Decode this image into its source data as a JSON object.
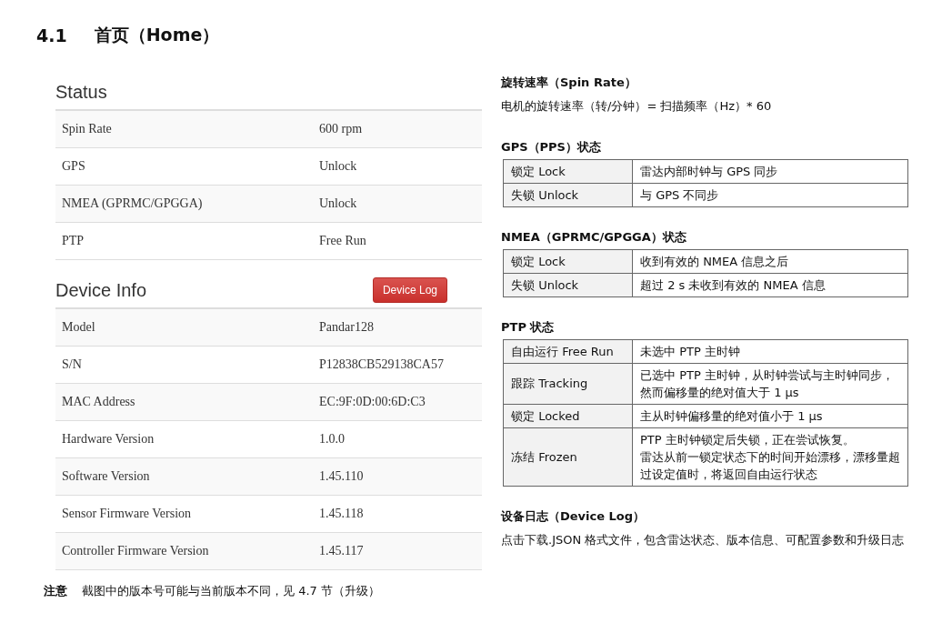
{
  "heading": {
    "number": "4.1",
    "title": "首页（Home）"
  },
  "status": {
    "title": "Status",
    "rows": [
      {
        "label": "Spin Rate",
        "value": "600 rpm"
      },
      {
        "label": "GPS",
        "value": "Unlock"
      },
      {
        "label": "NMEA (GPRMC/GPGGA)",
        "value": "Unlock"
      },
      {
        "label": "PTP",
        "value": "Free Run"
      }
    ]
  },
  "device_info": {
    "title": "Device Info",
    "button": "Device Log",
    "rows": [
      {
        "label": "Model",
        "value": "Pandar128"
      },
      {
        "label": "S/N",
        "value": "P12838CB529138CA57"
      },
      {
        "label": "MAC Address",
        "value": "EC:9F:0D:00:6D:C3"
      },
      {
        "label": "Hardware Version",
        "value": "1.0.0"
      },
      {
        "label": "Software Version",
        "value": "1.45.110"
      },
      {
        "label": "Sensor Firmware Version",
        "value": "1.45.118"
      },
      {
        "label": "Controller Firmware Version",
        "value": "1.45.117"
      }
    ]
  },
  "note": {
    "label": "注意",
    "text": "截图中的版本号可能与当前版本不同，见 4.7 节（升级）"
  },
  "sections": [
    {
      "title": "旋转速率（Spin Rate）",
      "paragraph": "电机的旋转速率（转/分钟）= 扫描频率（Hz）* 60"
    },
    {
      "title": "GPS（PPS）状态",
      "table": [
        {
          "state": "锁定 Lock",
          "description": [
            "雷达内部时钟与 GPS 同步"
          ]
        },
        {
          "state": "失锁 Unlock",
          "description": [
            "与 GPS 不同步"
          ]
        }
      ]
    },
    {
      "title": "NMEA（GPRMC/GPGGA）状态",
      "table": [
        {
          "state": "锁定 Lock",
          "description": [
            "收到有效的 NMEA 信息之后"
          ]
        },
        {
          "state": "失锁 Unlock",
          "description": [
            "超过 2 s 未收到有效的 NMEA 信息"
          ]
        }
      ]
    },
    {
      "title": "PTP 状态",
      "table": [
        {
          "state": "自由运行 Free Run",
          "description": [
            "未选中 PTP 主时钟"
          ]
        },
        {
          "state": "跟踪 Tracking",
          "description": [
            "已选中 PTP 主时钟，从时钟尝试与主时钟同步，然而偏移量的绝对值大于 1 µs"
          ]
        },
        {
          "state": "锁定 Locked",
          "description": [
            "主从时钟偏移量的绝对值小于 1 µs"
          ]
        },
        {
          "state": "冻结 Frozen",
          "description": [
            "PTP 主时钟锁定后失锁，正在尝试恢复。",
            "雷达从前一锁定状态下的时间开始漂移，漂移量超过设定值时，将返回自由运行状态"
          ]
        }
      ]
    },
    {
      "title": "设备日志（Device Log）",
      "paragraph": "点击下载.JSON 格式文件，包含雷达状态、版本信息、可配置参数和升级日志"
    }
  ]
}
